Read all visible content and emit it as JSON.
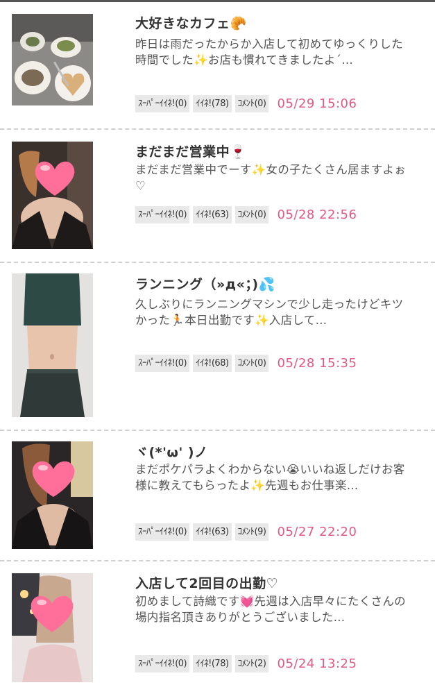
{
  "posts": [
    {
      "title": "大好きなカフェ🥐",
      "body": "昨日は雨だったからか入店して初めてゆっくりした時間でした✨お店も慣れてきましたよ´…",
      "super_like": "ｽｰﾊﾟｰｲｲﾈ!(0)",
      "like": "ｲｲﾈ!(78)",
      "comment": "ｺﾒﾝﾄ(0)",
      "date": "05/29 15:06",
      "thumb_icon": "cafe-food-photo"
    },
    {
      "title": "まだまだ営業中🍷",
      "body": "まだまだ営業中でーす✨女の子たくさん居ますよぉ♡",
      "super_like": "ｽｰﾊﾟｰｲｲﾈ!(0)",
      "like": "ｲｲﾈ!(63)",
      "comment": "ｺﾒﾝﾄ(0)",
      "date": "05/28 22:56",
      "thumb_icon": "portrait-heart-photo"
    },
    {
      "title": "ランニング（»д«；)💦",
      "body": "久しぶりにランニングマシンで少し走ったけどキツかった🏃本日出勤です✨入店して…",
      "super_like": "ｽｰﾊﾟｰｲｲﾈ!(0)",
      "like": "ｲｲﾈ!(68)",
      "comment": "ｺﾒﾝﾄ(0)",
      "date": "05/28 15:35",
      "thumb_icon": "fitness-photo"
    },
    {
      "title": "ヾ(*'ω'  )ノ",
      "body": "まだポケパラよくわからない😭いいね返しだけお客様に教えてもらったよ✨先週もお仕事楽…",
      "super_like": "ｽｰﾊﾟｰｲｲﾈ!(0)",
      "like": "ｲｲﾈ!(63)",
      "comment": "ｺﾒﾝﾄ(9)",
      "date": "05/27 22:20",
      "thumb_icon": "portrait-heart-photo"
    },
    {
      "title": "入店して2回目の出勤♡",
      "body": "初めまして詩織です💓先週は入店早々にたくさんの場内指名頂きありがとうございました…",
      "super_like": "ｽｰﾊﾟｰｲｲﾈ!(0)",
      "like": "ｲｲﾈ!(78)",
      "comment": "ｺﾒﾝﾄ(2)",
      "date": "05/24 13:25",
      "thumb_icon": "portrait-heart-photo"
    }
  ],
  "colors": {
    "date": "#e05a84",
    "chip_bg": "#e9e9e9",
    "heart": "#ff6f9a",
    "divider": "#cfcfcf"
  }
}
